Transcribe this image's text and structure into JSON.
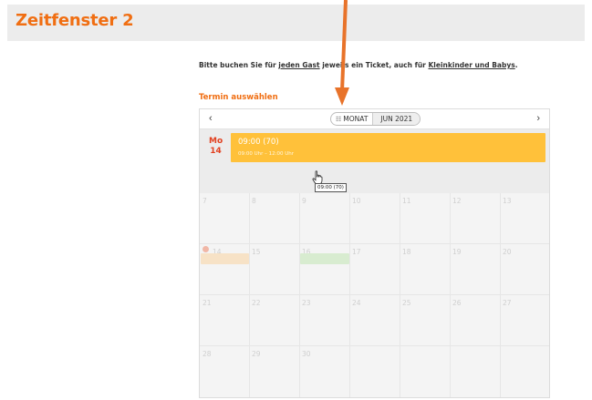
{
  "page": {
    "title": "Zeitfenster 2",
    "info": {
      "part1": "Bitte buchen Sie für ",
      "link1": "jeden Gast",
      "part2": " jeweils ein Ticket, auch für ",
      "link2": "Kleinkinder und Babys",
      "part3": "."
    },
    "section_heading": "Termin auswählen"
  },
  "calendar": {
    "nav_prev": "‹",
    "nav_next": "›",
    "view_mode": "MONAT",
    "current_month": "JUN 2021",
    "day_panel": {
      "weekday": "Mo",
      "day": "14"
    },
    "event": {
      "title": "09:00 (70)",
      "time": "09:00 Uhr – 12:00 Uhr"
    },
    "tooltip": "09:00 (70)",
    "week_rows": [
      [
        "7",
        "8",
        "9",
        "10",
        "11",
        "12",
        "13"
      ],
      [
        "14",
        "15",
        "16",
        "17",
        "18",
        "19",
        "20"
      ],
      [
        "21",
        "22",
        "23",
        "24",
        "25",
        "26",
        "27"
      ],
      [
        "28",
        "29",
        "30",
        "",
        "",
        "",
        ""
      ]
    ]
  },
  "colors": {
    "accent": "#f06e12",
    "event": "#ffc13a",
    "arrow": "#e8732a"
  }
}
